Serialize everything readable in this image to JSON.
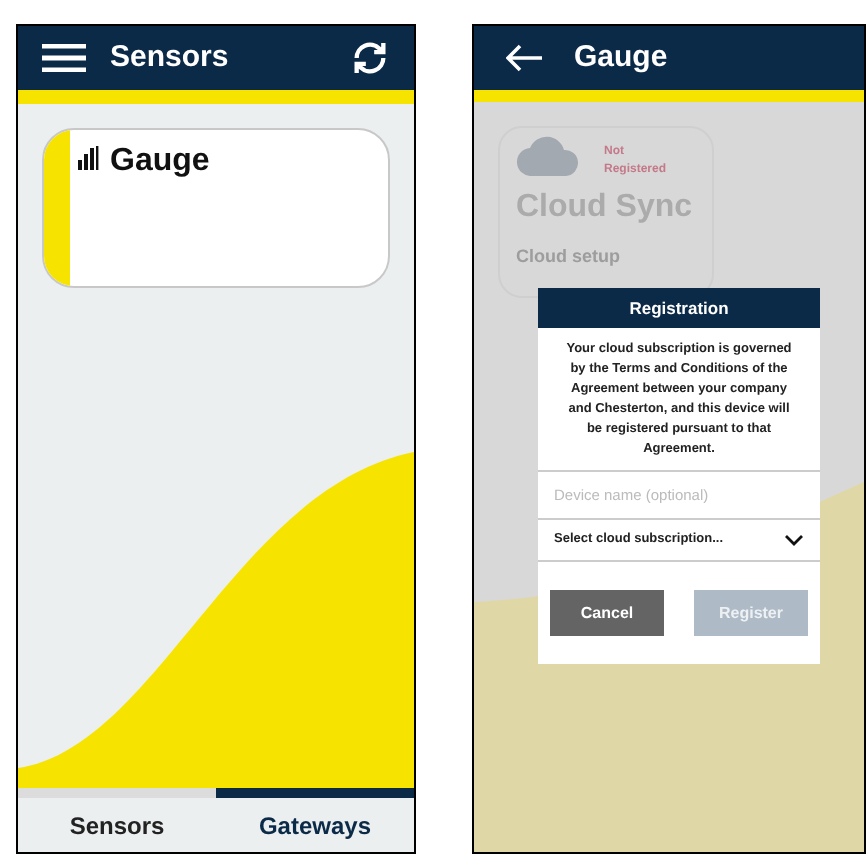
{
  "sensors_screen": {
    "header": {
      "title": "Sensors"
    },
    "card": {
      "title": "Gauge"
    },
    "tabs": [
      {
        "label": "Sensors",
        "selected": false
      },
      {
        "label": "Gateways",
        "selected": true
      }
    ]
  },
  "gauge_screen": {
    "header": {
      "title": "Gauge"
    },
    "card": {
      "status": "Not Registered",
      "title": "Cloud Sync",
      "subtitle": "Cloud setup"
    },
    "dialog": {
      "title": "Registration",
      "message": "Your cloud subscription is governed by the Terms and Conditions of the Agreement between your company and Chesterton, and this device will be registered pursuant to that Agreement.",
      "device_field": {
        "placeholder": "Device name (optional)"
      },
      "subscription_select": {
        "value": "Select cloud subscription..."
      },
      "buttons": [
        {
          "label": "Cancel",
          "kind": "cancel",
          "disabled": false
        },
        {
          "label": "Register",
          "kind": "primary",
          "disabled": true
        }
      ]
    }
  }
}
